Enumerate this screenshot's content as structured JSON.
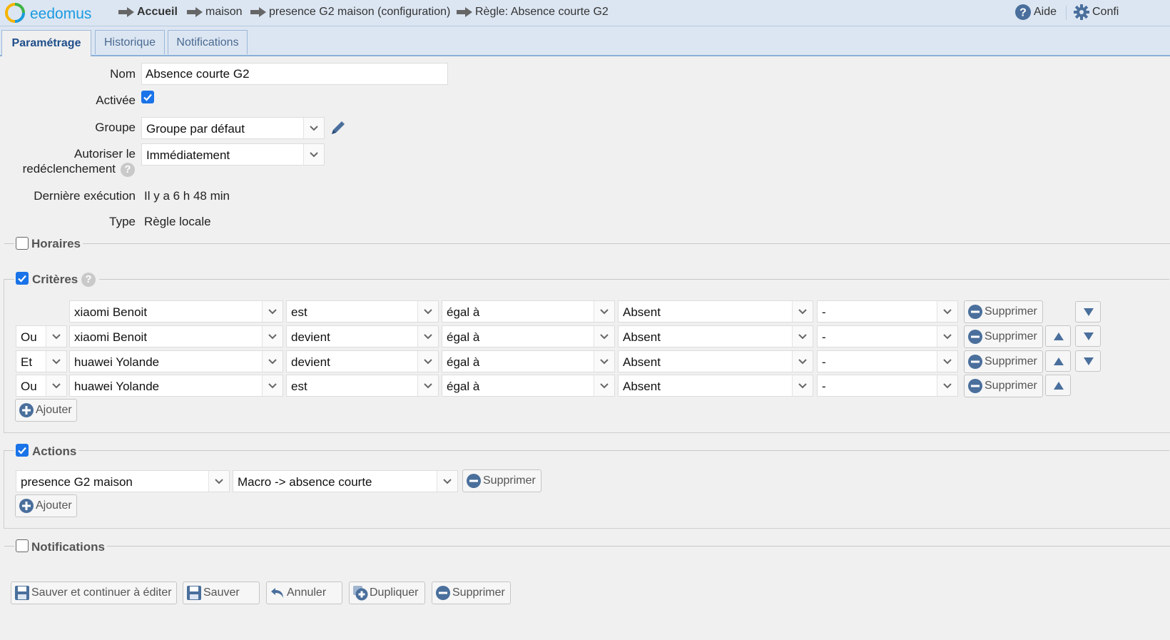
{
  "brand": {
    "name": "eedomus"
  },
  "breadcrumb": [
    "Accueil",
    "maison",
    "presence G2 maison (configuration)",
    "Règle: Absence courte G2"
  ],
  "top_right": {
    "help_label": "Aide",
    "config_label": "Confi"
  },
  "tabs": [
    {
      "label": "Paramétrage",
      "active": true
    },
    {
      "label": "Historique",
      "active": false
    },
    {
      "label": "Notifications",
      "active": false
    }
  ],
  "form": {
    "name_label": "Nom",
    "name_value": "Absence courte G2",
    "active_label": "Activée",
    "active_checked": true,
    "group_label": "Groupe",
    "group_value": "Groupe par défaut",
    "retrigger_label_1": "Autoriser le",
    "retrigger_label_2": "redéclenchement",
    "retrigger_value": "Immédiatement",
    "last_exec_label": "Dernière exécution",
    "last_exec_value": "Il y a 6 h 48 min",
    "type_label": "Type",
    "type_value": "Règle locale"
  },
  "sections": {
    "horaires": {
      "label": "Horaires",
      "checked": false
    },
    "criteres": {
      "label": "Critères",
      "checked": true
    },
    "actions": {
      "label": "Actions",
      "checked": true
    },
    "notifications": {
      "label": "Notifications",
      "checked": false
    }
  },
  "criteria": [
    {
      "op": "",
      "device": "xiaomi Benoit",
      "event": "est",
      "comparator": "égal à",
      "value": "Absent",
      "extra": "-",
      "delete_label": "Supprimer"
    },
    {
      "op": "Ou",
      "device": "xiaomi Benoit",
      "event": "devient",
      "comparator": "égal à",
      "value": "Absent",
      "extra": "-",
      "delete_label": "Supprimer"
    },
    {
      "op": "Et",
      "device": "huawei Yolande",
      "event": "devient",
      "comparator": "égal à",
      "value": "Absent",
      "extra": "-",
      "delete_label": "Supprimer"
    },
    {
      "op": "Ou",
      "device": "huawei Yolande",
      "event": "est",
      "comparator": "égal à",
      "value": "Absent",
      "extra": "-",
      "delete_label": "Supprimer"
    }
  ],
  "criteria_add_label": "Ajouter",
  "actions": [
    {
      "device": "presence G2 maison",
      "action": "Macro -> absence courte",
      "delete_label": "Supprimer"
    }
  ],
  "actions_add_label": "Ajouter",
  "footer": {
    "save_continue": "Sauver et continuer à éditer",
    "save": "Sauver",
    "cancel": "Annuler",
    "duplicate": "Dupliquer",
    "delete": "Supprimer"
  },
  "colors": {
    "accent": "#1a73e8",
    "tab_bar": "#dce6f2",
    "brand": "#1a9be0"
  }
}
